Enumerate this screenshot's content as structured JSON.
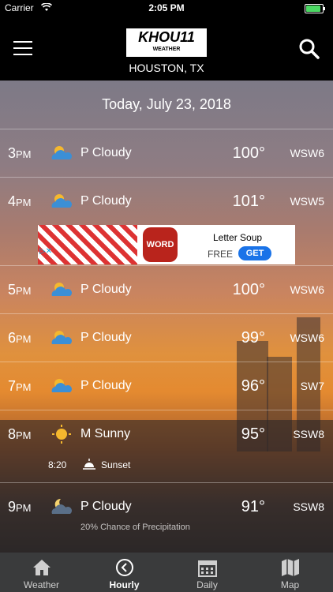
{
  "status_bar": {
    "carrier": "Carrier",
    "time": "2:05 PM"
  },
  "header": {
    "logo_text": "KHOU11",
    "logo_sub": "WEATHER",
    "location": "HOUSTON, TX"
  },
  "date": "Today, July 23, 2018",
  "hours": [
    {
      "hour": "3",
      "ampm": "PM",
      "icon": "partly-cloudy-icon",
      "condition": "P Cloudy",
      "temp": "100°",
      "wind": "WSW6"
    },
    {
      "hour": "4",
      "ampm": "PM",
      "icon": "partly-cloudy-icon",
      "condition": "P Cloudy",
      "temp": "101°",
      "wind": "WSW5"
    },
    {
      "hour": "5",
      "ampm": "PM",
      "icon": "partly-cloudy-icon",
      "condition": "P Cloudy",
      "temp": "100°",
      "wind": "WSW6"
    },
    {
      "hour": "6",
      "ampm": "PM",
      "icon": "partly-cloudy-icon",
      "condition": "P Cloudy",
      "temp": "99°",
      "wind": "WSW6"
    },
    {
      "hour": "7",
      "ampm": "PM",
      "icon": "partly-cloudy-icon",
      "condition": "P Cloudy",
      "temp": "96°",
      "wind": "SW7"
    },
    {
      "hour": "8",
      "ampm": "PM",
      "icon": "sunny-icon",
      "condition": "M Sunny",
      "temp": "95°",
      "wind": "SSW8"
    },
    {
      "hour": "9",
      "ampm": "PM",
      "icon": "night-cloudy-icon",
      "condition": "P Cloudy",
      "temp": "91°",
      "wind": "SSW8"
    }
  ],
  "sunset": {
    "time": "8:20",
    "label": "Sunset"
  },
  "precip": "20% Chance of Precipitation",
  "ad": {
    "title": "Letter Soup",
    "free_label": "FREE",
    "get_label": "GET",
    "icon_text": "WORD"
  },
  "tabs": [
    {
      "label": "Weather",
      "icon": "home-icon",
      "active": false
    },
    {
      "label": "Hourly",
      "icon": "clock-icon",
      "active": true
    },
    {
      "label": "Daily",
      "icon": "calendar-icon",
      "active": false
    },
    {
      "label": "Map",
      "icon": "map-icon",
      "active": false
    }
  ],
  "colors": {
    "header_bg": "#000000",
    "tabbar_bg": "#3a3b3c",
    "battery": "#4cd964",
    "ad_button": "#1a73e8"
  }
}
